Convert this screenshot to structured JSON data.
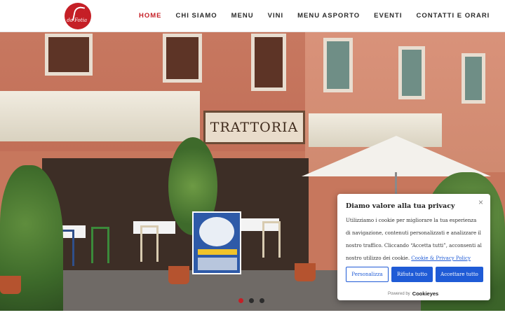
{
  "header": {
    "logo_text": "da Fotia",
    "nav": [
      "HOME",
      "CHI SIAMO",
      "MENU",
      "VINI",
      "MENU ASPORTO",
      "EVENTI",
      "CONTATTI E ORARI"
    ],
    "active_index": 0,
    "accent_color": "#c51f26"
  },
  "hero": {
    "sign_text": "TRATTORIA",
    "slides": 3,
    "active_slide": 0
  },
  "cookie": {
    "title": "Diamo valore alla tua privacy",
    "text": "Utilizziamo i cookie per migliorare la tua esperienza di navigazione, contenuti personalizzati e analizzare il nostro traffico. Cliccando “Accetta tutti”, acconsenti al nostro utilizzo dei cookie.",
    "policy_link": "Cookie & Privacy Policy",
    "customize_label": "Personalizza",
    "reject_label": "Rifiuta tutto",
    "accept_label": "Accettare tutto",
    "powered_prefix": "Powered by",
    "powered_brand": "Cookieyes",
    "close_icon": "close-icon",
    "button_color": "#1f5bd6"
  }
}
